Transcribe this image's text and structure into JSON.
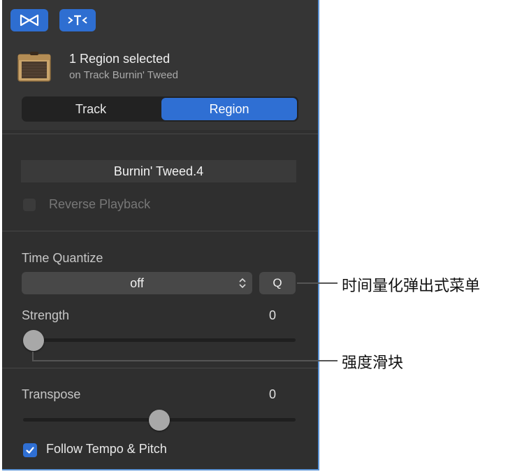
{
  "toolbar": {
    "library_icon": "bowtie-icon",
    "smart_controls_icon": "arrows-y-icon"
  },
  "header": {
    "title": "1 Region selected",
    "subtitle": "on Track Burnin' Tweed"
  },
  "tabs": {
    "track": "Track",
    "region": "Region",
    "selected": "Region"
  },
  "region": {
    "name": "Burnin' Tweed.4",
    "reverse_label": "Reverse Playback",
    "reverse_checked": false
  },
  "time_quantize": {
    "label": "Time Quantize",
    "value": "off",
    "q_label": "Q"
  },
  "strength": {
    "label": "Strength",
    "value": "0",
    "slider_fraction": 0
  },
  "transpose": {
    "label": "Transpose",
    "value": "0",
    "slider_fraction": 0.5
  },
  "follow": {
    "label": "Follow Tempo & Pitch",
    "checked": true
  },
  "callouts": {
    "quantize_popup": "时间量化弹出式菜单",
    "strength_slider": "强度滑块"
  },
  "colors": {
    "accent": "#2f6fd3",
    "panel_bg": "#2f2f2f"
  }
}
